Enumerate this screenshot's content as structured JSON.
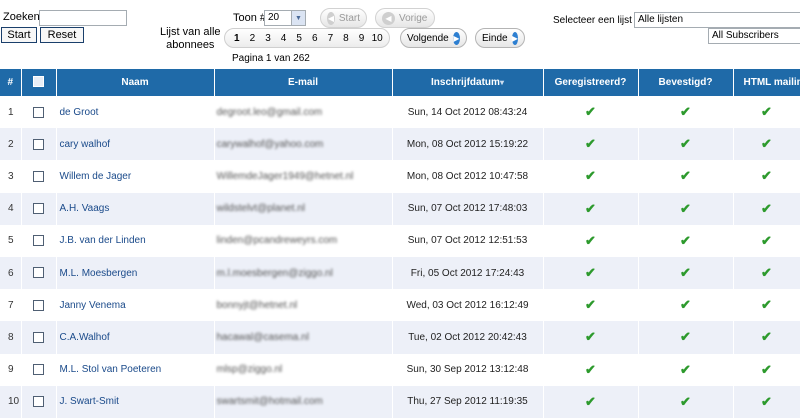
{
  "search": {
    "label": "Zoeken",
    "value": "",
    "start_label": "Start",
    "reset_label": "Reset"
  },
  "list_title": [
    "Lijst van alle",
    "abonnees"
  ],
  "toon": {
    "label": "Toon #",
    "value": "20"
  },
  "nav": {
    "start": "Start",
    "vorige": "Vorige",
    "volgende": "Volgende",
    "einde": "Einde"
  },
  "pages": [
    "1",
    "2",
    "3",
    "4",
    "5",
    "6",
    "7",
    "8",
    "9",
    "10"
  ],
  "current_page": "1",
  "page_info": "Pagina 1 van 262",
  "list_select": {
    "label": "Selecteer een lijst",
    "value": "Alle lijsten"
  },
  "subscriber_select": {
    "value": "All Subscribers"
  },
  "table": {
    "headers": [
      "#",
      "",
      "Naam",
      "E-mail",
      "Inschrijfdatum",
      "Geregistreerd?",
      "Bevestigd?",
      "HTML mailings"
    ],
    "rows": [
      {
        "num": "1",
        "name": "de Groot",
        "email": "degroot.leo@gmail.com",
        "date": "Sun, 14 Oct 2012 08:43:24"
      },
      {
        "num": "2",
        "name": "cary walhof",
        "email": "carywalhof@yahoo.com",
        "date": "Mon, 08 Oct 2012 15:19:22"
      },
      {
        "num": "3",
        "name": "Willem de Jager",
        "email": "WillemdeJager1949@hetnet.nl",
        "date": "Mon, 08 Oct 2012 10:47:58"
      },
      {
        "num": "4",
        "name": "A.H. Vaags",
        "email": "wildstelvt@planet.nl",
        "date": "Sun, 07 Oct 2012 17:48:03"
      },
      {
        "num": "5",
        "name": "J.B. van der Linden",
        "email": "linden@pcandreweyrs.com",
        "date": "Sun, 07 Oct 2012 12:51:53"
      },
      {
        "num": "6",
        "name": "M.L. Moesbergen",
        "email": "m.l.moesbergen@ziggo.nl",
        "date": "Fri, 05 Oct 2012 17:24:43"
      },
      {
        "num": "7",
        "name": "Janny Venema",
        "email": "bonnyjt@hetnet.nl",
        "date": "Wed, 03 Oct 2012 16:12:49"
      },
      {
        "num": "8",
        "name": "C.A.Walhof",
        "email": "hacawal@casema.nl",
        "date": "Tue, 02 Oct 2012 20:42:43"
      },
      {
        "num": "9",
        "name": "M.L. Stol van Poeteren",
        "email": "mlsp@ziggo.nl",
        "date": "Sun, 30 Sep 2012 13:12:48"
      },
      {
        "num": "10",
        "name": "J. Swart-Smit",
        "email": "swartsmit@hotmail.com",
        "date": "Thu, 27 Sep 2012 11:19:35"
      }
    ]
  },
  "tick_glyph": "✔",
  "colors": {
    "header_bg": "#1f6aa8",
    "row_alt": "#edf0f8",
    "link": "#1a4a8a",
    "tick": "#2d9a2d"
  }
}
